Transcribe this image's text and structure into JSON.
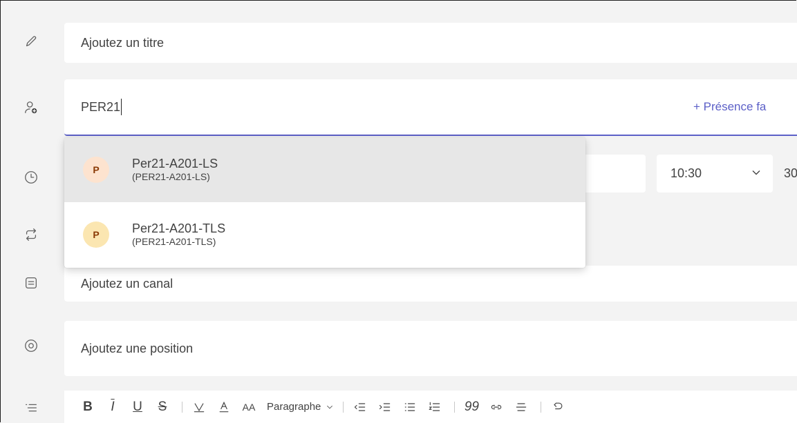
{
  "title_field": {
    "placeholder": "Ajoutez un titre"
  },
  "attendee_field": {
    "value": "PER21",
    "presence_link": "+ Présence fa"
  },
  "time": {
    "start_time": "10:30",
    "end_time_partial": "30"
  },
  "suggestions": [
    {
      "initial": "P",
      "name": "Per21-A201-LS",
      "sub": "(PER21-A201-LS)",
      "avatar_color": "#fde3cf"
    },
    {
      "initial": "P",
      "name": "Per21-A201-TLS",
      "sub": "(PER21-A201-TLS)",
      "avatar_color": "#fbe6b1"
    }
  ],
  "channel_field": {
    "placeholder": "Ajoutez un canal"
  },
  "location_field": {
    "placeholder": "Ajoutez une position"
  },
  "toolbar": {
    "bold": "B",
    "italic": "I",
    "underline": "U",
    "strike": "S",
    "font_size": "AA",
    "paragraph": "Paragraphe",
    "quote": "99"
  },
  "colors": {
    "accent": "#5b5fc7",
    "selected_row": "#e7e7e7"
  },
  "icons": [
    "pencil-icon",
    "add-person-icon",
    "clock-icon",
    "repeat-icon",
    "channel-icon",
    "location-icon",
    "details-list-icon"
  ]
}
